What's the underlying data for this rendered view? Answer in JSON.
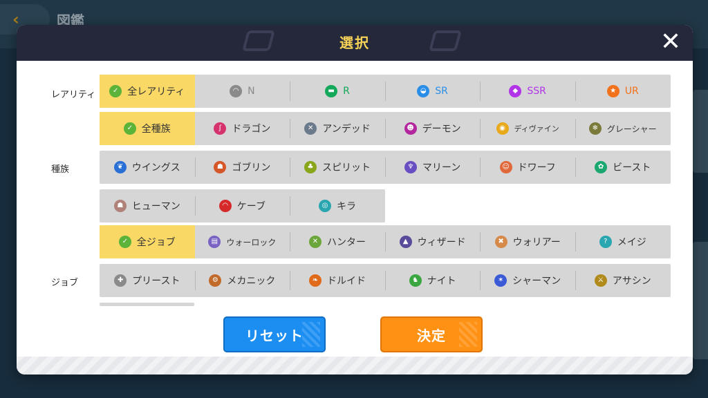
{
  "background": {
    "page_title": "図鑑"
  },
  "modal": {
    "title": "選択",
    "close_label": "✕"
  },
  "rarity": {
    "label": "レアリティ",
    "items": [
      {
        "label": "全レアリティ",
        "icon": "check-icon",
        "color": "#5bb33a",
        "selected": true
      },
      {
        "label": "N",
        "icon": "rarity-n-icon",
        "color": "#8a8a8a",
        "text_color": "#8a8a8a"
      },
      {
        "label": "R",
        "icon": "rarity-r-icon",
        "color": "#14a85a",
        "text_color": "#14a85a"
      },
      {
        "label": "SR",
        "icon": "rarity-sr-icon",
        "color": "#2a8ee8",
        "text_color": "#2a8ee8"
      },
      {
        "label": "SSR",
        "icon": "rarity-ssr-icon",
        "color": "#b134e8",
        "text_color": "#b134e8"
      },
      {
        "label": "UR",
        "icon": "rarity-ur-icon",
        "color": "#f2711b",
        "text_color": "#f2711b"
      }
    ]
  },
  "race": {
    "label": "種族",
    "rows": [
      [
        {
          "label": "全種族",
          "icon": "check-icon",
          "color": "#5bb33a",
          "selected": true
        },
        {
          "label": "ドラゴン",
          "icon": "dragon-icon",
          "color": "#d6326e"
        },
        {
          "label": "アンデッド",
          "icon": "undead-icon",
          "color": "#6b7a8a"
        },
        {
          "label": "デーモン",
          "icon": "demon-icon",
          "color": "#b3269e"
        },
        {
          "label": "ディヴァイン",
          "icon": "divine-icon",
          "color": "#e8a91b",
          "size": "xs"
        },
        {
          "label": "グレーシャー",
          "icon": "glacier-icon",
          "color": "#7a7a3a",
          "size": "small"
        }
      ],
      [
        {
          "label": "ウイングス",
          "icon": "wings-icon",
          "color": "#2a6fd6"
        },
        {
          "label": "ゴブリン",
          "icon": "goblin-icon",
          "color": "#d6582a"
        },
        {
          "label": "スピリット",
          "icon": "spirit-icon",
          "color": "#8aa61b"
        },
        {
          "label": "マリーン",
          "icon": "marine-icon",
          "color": "#6a4fc2"
        },
        {
          "label": "ドワーフ",
          "icon": "dwarf-icon",
          "color": "#e0683a"
        },
        {
          "label": "ビースト",
          "icon": "beast-icon",
          "color": "#1aa870"
        }
      ],
      [
        {
          "label": "ヒューマン",
          "icon": "human-icon",
          "color": "#b0827a"
        },
        {
          "label": "ケーブ",
          "icon": "cave-icon",
          "color": "#d62a2a"
        },
        {
          "label": "キラ",
          "icon": "kira-icon",
          "color": "#2aa6b0"
        }
      ]
    ]
  },
  "job": {
    "label": "ジョブ",
    "rows": [
      [
        {
          "label": "全ジョブ",
          "icon": "check-icon",
          "color": "#5bb33a",
          "selected": true
        },
        {
          "label": "ウォーロック",
          "icon": "warlock-icon",
          "color": "#7a62c2",
          "size": "small"
        },
        {
          "label": "ハンター",
          "icon": "hunter-icon",
          "color": "#6aa63a"
        },
        {
          "label": "ウィザード",
          "icon": "wizard-icon",
          "color": "#5a4a9a"
        },
        {
          "label": "ウォリアー",
          "icon": "warrior-icon",
          "color": "#d68a4a"
        },
        {
          "label": "メイジ",
          "icon": "mage-icon",
          "color": "#2aa6b0"
        }
      ],
      [
        {
          "label": "プリースト",
          "icon": "priest-icon",
          "color": "#8a8a8a"
        },
        {
          "label": "メカニック",
          "icon": "mechanic-icon",
          "color": "#c26a2a"
        },
        {
          "label": "ドルイド",
          "icon": "druid-icon",
          "color": "#e06a1a"
        },
        {
          "label": "ナイト",
          "icon": "knight-icon",
          "color": "#3aa640"
        },
        {
          "label": "シャーマン",
          "icon": "shaman-icon",
          "color": "#3a5ad6"
        },
        {
          "label": "アサシン",
          "icon": "assassin-icon",
          "color": "#b08a1a"
        }
      ]
    ]
  },
  "buttons": {
    "reset": "リセット",
    "confirm": "決定"
  }
}
